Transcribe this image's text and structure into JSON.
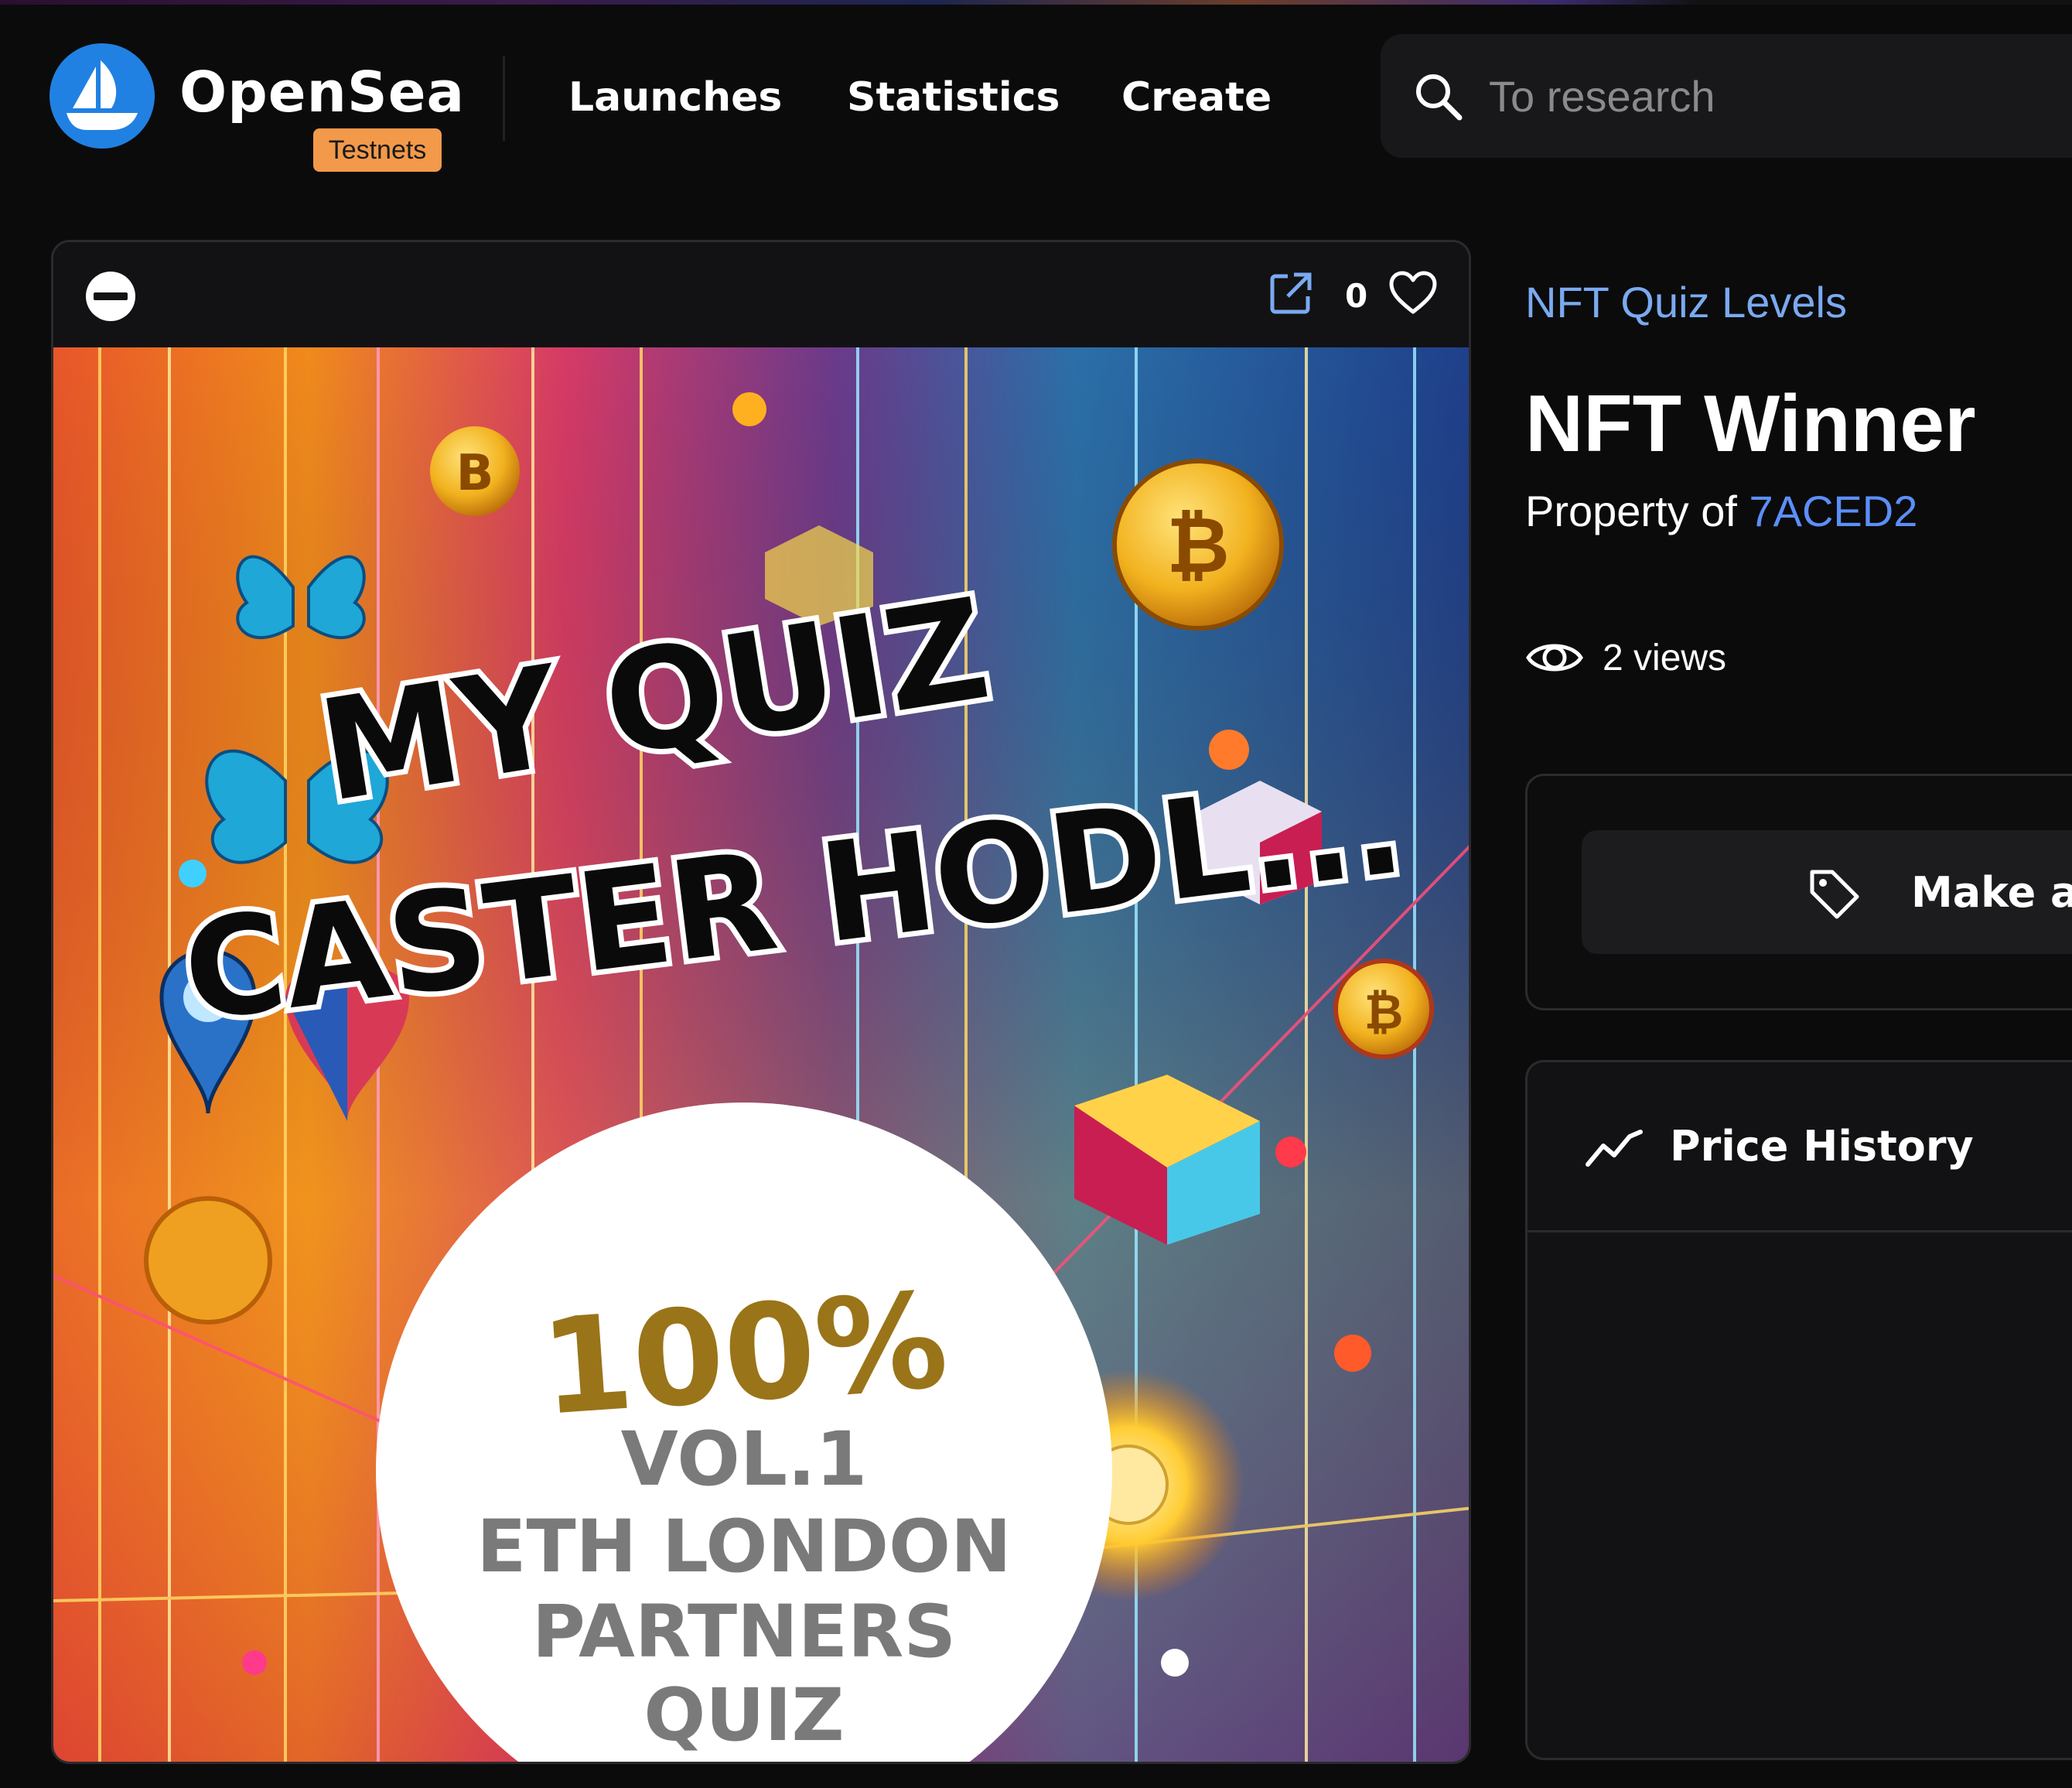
{
  "header": {
    "brand_name": "OpenSea",
    "network_badge": "Testnets",
    "nav": [
      {
        "label": "Launches"
      },
      {
        "label": "Statistics"
      },
      {
        "label": "Create"
      }
    ],
    "search": {
      "placeholder": "To research",
      "value": ""
    }
  },
  "media": {
    "like_count": "0",
    "artwork_text": {
      "headline_line1": "MY QUIZ",
      "headline_line2": "CASTER HODL...",
      "score": "100%",
      "line1": "VOL.1",
      "line2": "ETH LONDON",
      "line3": "PARTNERS",
      "line4": "QUIZ"
    },
    "icons": [
      "chain-icon",
      "external-link-icon",
      "heart-icon"
    ]
  },
  "item": {
    "collection": "NFT Quiz Levels",
    "title": "NFT Winner",
    "owner_prefix": "Property of",
    "owner": "7ACED2",
    "views": "2 views"
  },
  "offer": {
    "label": "Make ar"
  },
  "price_history": {
    "title": "Price History"
  },
  "colors": {
    "background": "#0b0b0c",
    "brand_blue": "#2081e2",
    "badge_orange": "#f2994a",
    "link_blue": "#7aaaf0",
    "owner_blue": "#5b8ff9",
    "score_gold": "#9a7419"
  }
}
